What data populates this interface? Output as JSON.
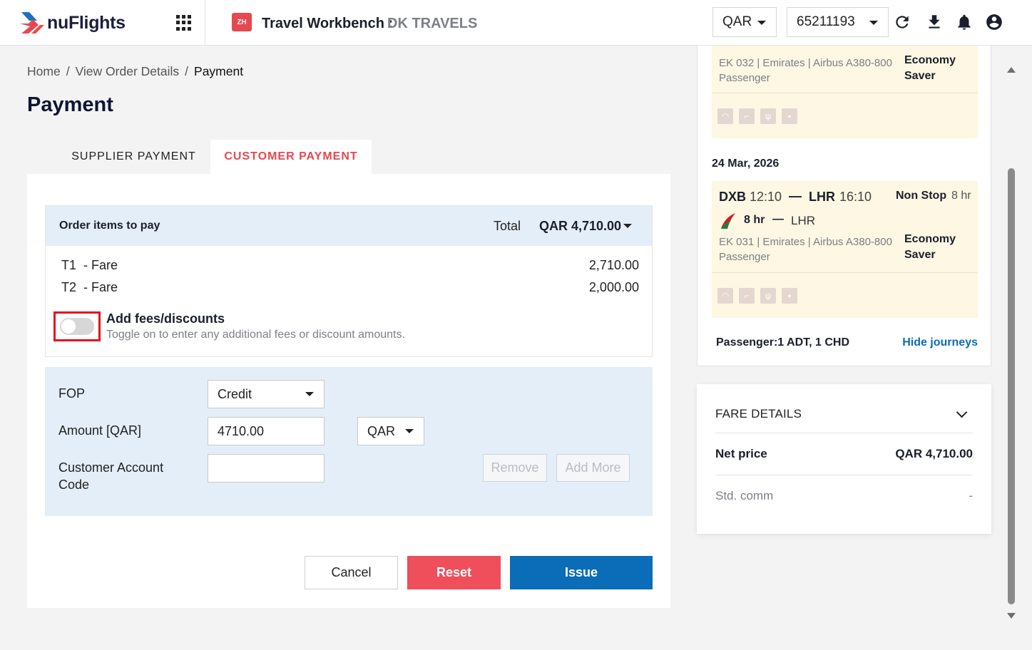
{
  "header": {
    "logo_text": "nuFlights",
    "workbench_icon_text": "ZH",
    "workbench_title": "Travel Workbench :",
    "agency": "DK TRAVELS",
    "currency": "QAR",
    "account_id": "65211193",
    "icons": [
      "apps-grid-icon",
      "refresh-icon",
      "download-icon",
      "bell-icon",
      "account-icon"
    ]
  },
  "breadcrumb": {
    "home": "Home",
    "sep": "/",
    "view_order": "View Order Details",
    "current": "Payment"
  },
  "page_title": "Payment",
  "tabs": {
    "supplier": "SUPPLIER PAYMENT",
    "customer": "CUSTOMER PAYMENT",
    "active": "customer"
  },
  "order": {
    "label": "Order items to pay",
    "total_label": "Total",
    "total_value": "QAR 4,710.00",
    "items": [
      {
        "label": "T1  - Fare",
        "amount": "2,710.00"
      },
      {
        "label": "T2  - Fare",
        "amount": "2,000.00"
      }
    ],
    "fees_toggle_on": false,
    "fees_title": "Add fees/discounts",
    "fees_subtitle": "Toggle on to enter any additional fees or discount amounts."
  },
  "fop": {
    "fop_label": "FOP",
    "fop_value": "Credit",
    "amount_label": "Amount [QAR]",
    "amount_value": "4710.00",
    "amount_currency": "QAR",
    "account_code_label": "Customer Account Code",
    "account_code_value": "",
    "remove_label": "Remove",
    "add_more_label": "Add More"
  },
  "actions": {
    "cancel": "Cancel",
    "reset": "Reset",
    "issue": "Issue"
  },
  "journey": {
    "prev_segment": {
      "flight_info": "EK 032 | Emirates | Airbus A380-800",
      "passenger": "Passenger",
      "cabin_line1": "Economy",
      "cabin_line2": "Saver"
    },
    "date": "24 Mar, 2026",
    "segment": {
      "from": "DXB",
      "dep_time": "12:10",
      "dash": "—",
      "to": "LHR",
      "arr_time": "16:10",
      "stops": "Non Stop",
      "duration": "8 hr",
      "leg_duration": "8 hr",
      "leg_dest": "LHR",
      "flight_info": "EK 031 | Emirates | Airbus A380-800",
      "passenger": "Passenger",
      "cabin_line1": "Economy",
      "cabin_line2": "Saver"
    },
    "amenity_icons": [
      "wifi-icon",
      "seat-icon",
      "meal-icon",
      "baggage-icon"
    ],
    "passenger_summary": "Passenger:1 ADT, 1 CHD",
    "hide_link": "Hide journeys"
  },
  "fare_details": {
    "title": "FARE DETAILS",
    "net_price_label": "Net price",
    "net_price_value": "QAR 4,710.00",
    "std_comm_label": "Std. comm",
    "std_comm_value": "-"
  },
  "colors": {
    "brand_red": "#e8474f",
    "issue_blue": "#0b6cb8",
    "reset_red": "#ef4e5b",
    "highlight_border": "#e4111f",
    "segment_bg": "#fdf7e3",
    "fop_bg": "#e3eef8"
  }
}
